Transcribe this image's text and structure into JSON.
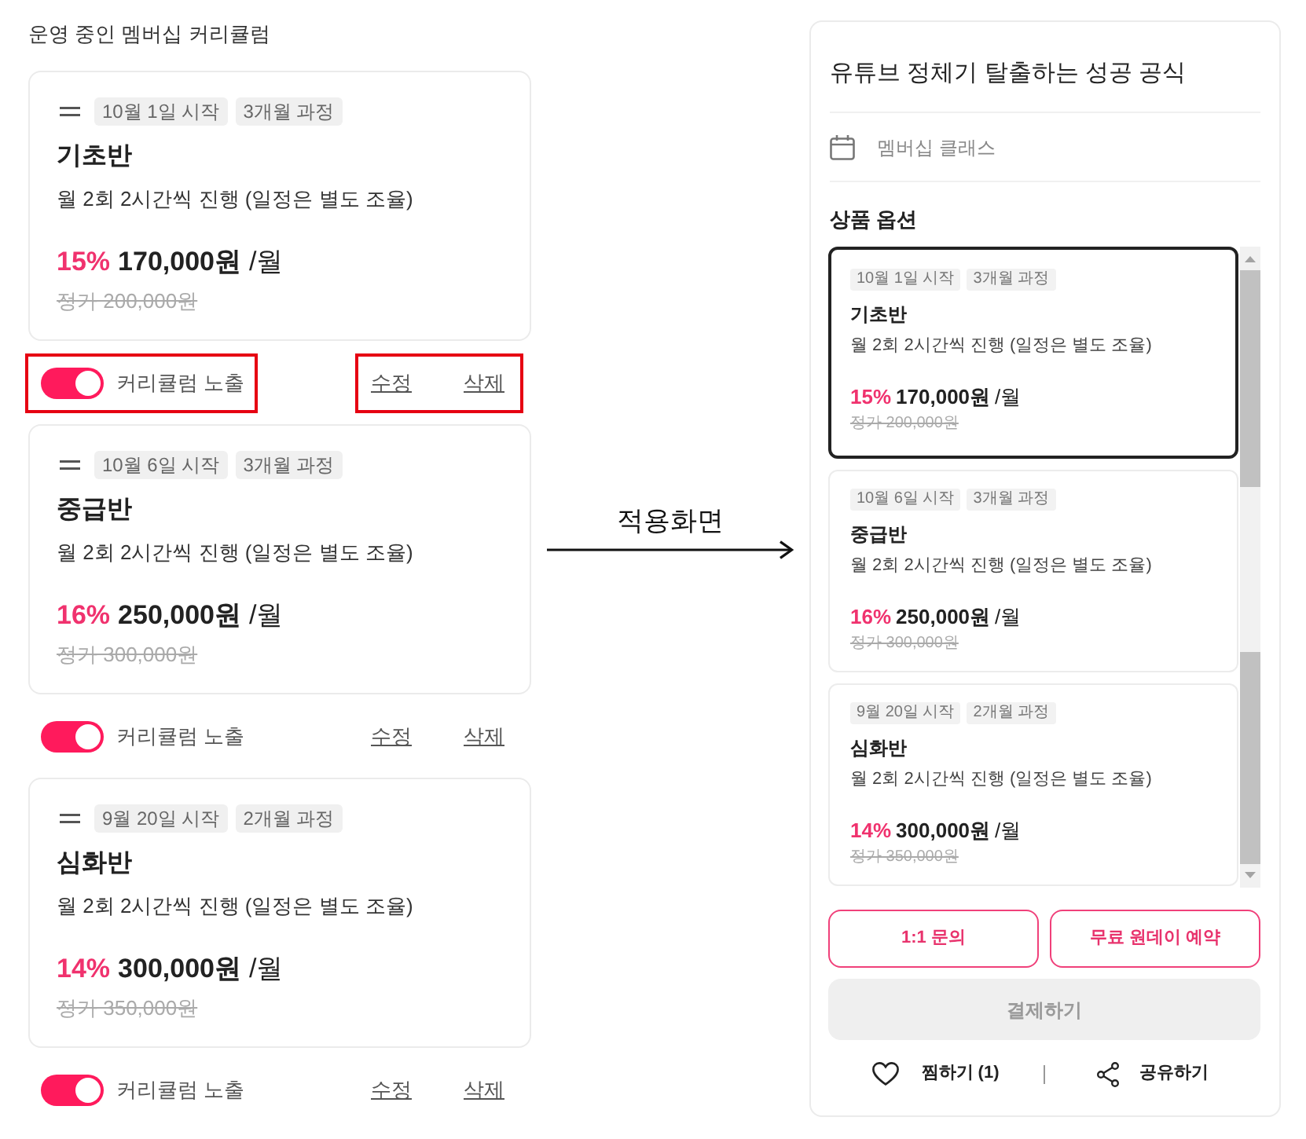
{
  "left_panel": {
    "heading": "운영 중인 멤버십 커리큘럼",
    "curricula": [
      {
        "tags": [
          "10월 1일 시작",
          "3개월 과정"
        ],
        "title": "기초반",
        "description": "월 2회 2시간씩 진행 (일정은 별도 조율)",
        "discount": "15%",
        "price": "170,000원",
        "unit": "/월",
        "original_price": "정가 200,000원",
        "toggle_label": "커리큘럼 노출",
        "on": true,
        "edit": "수정",
        "delete": "삭제",
        "highlighted": true
      },
      {
        "tags": [
          "10월 6일 시작",
          "3개월 과정"
        ],
        "title": "중급반",
        "description": "월 2회 2시간씩 진행 (일정은 별도 조율)",
        "discount": "16%",
        "price": "250,000원",
        "unit": "/월",
        "original_price": "정가 300,000원",
        "toggle_label": "커리큘럼 노출",
        "on": true,
        "edit": "수정",
        "delete": "삭제",
        "highlighted": false
      },
      {
        "tags": [
          "9월 20일 시작",
          "2개월 과정"
        ],
        "title": "심화반",
        "description": "월 2회 2시간씩 진행 (일정은 별도 조율)",
        "discount": "14%",
        "price": "300,000원",
        "unit": "/월",
        "original_price": "정가 350,000원",
        "toggle_label": "커리큘럼 노출",
        "on": true,
        "edit": "수정",
        "delete": "삭제",
        "highlighted": false
      }
    ]
  },
  "arrow": {
    "label": "적용화면"
  },
  "preview": {
    "title": "유튜브 정체기 탈출하는 성공 공식",
    "category": "멤버십 클래스",
    "options_heading": "상품 옵션",
    "options": [
      {
        "tags": [
          "10월 1일 시작",
          "3개월 과정"
        ],
        "title": "기초반",
        "description": "월 2회 2시간씩 진행 (일정은 별도 조율)",
        "discount": "15%",
        "price": "170,000원",
        "unit": "/월",
        "original_price": "정가 200,000원",
        "selected": true
      },
      {
        "tags": [
          "10월 6일 시작",
          "3개월 과정"
        ],
        "title": "중급반",
        "description": "월 2회 2시간씩 진행 (일정은 별도 조율)",
        "discount": "16%",
        "price": "250,000원",
        "unit": "/월",
        "original_price": "정가 300,000원",
        "selected": false
      },
      {
        "tags": [
          "9월 20일 시작",
          "2개월 과정"
        ],
        "title": "심화반",
        "description": "월 2회 2시간씩 진행 (일정은 별도 조율)",
        "discount": "14%",
        "price": "300,000원",
        "unit": "/월",
        "original_price": "정가 350,000원",
        "selected": false
      }
    ],
    "buttons": [
      "1:1 문의",
      "무료 원데이 예약"
    ],
    "checkout": {
      "label": "결제하기",
      "disabled": true
    },
    "like": "찜하기 (1)",
    "share": "공유하기"
  }
}
